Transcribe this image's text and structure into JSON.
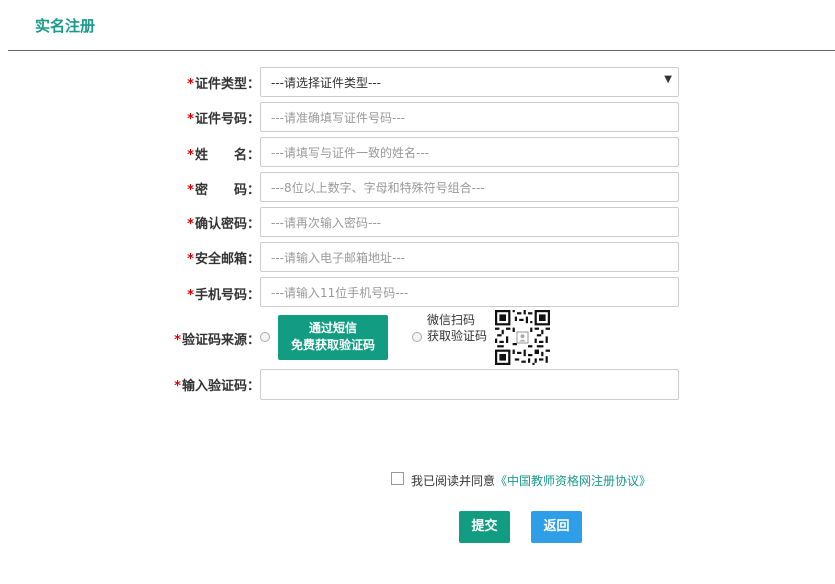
{
  "page": {
    "title": "实名注册"
  },
  "form": {
    "id_type": {
      "label": "证件类型：",
      "value": "---请选择证件类型---"
    },
    "id_number": {
      "label": "证件号码：",
      "placeholder": "---请准确填写证件号码---"
    },
    "name": {
      "label": "姓　　名：",
      "placeholder": "---请填写与证件一致的姓名---"
    },
    "password": {
      "label": "密　　码：",
      "placeholder": "---8位以上数字、字母和特殊符号组合---"
    },
    "confirm_password": {
      "label": "确认密码：",
      "placeholder": "---请再次输入密码---"
    },
    "email": {
      "label": "安全邮箱：",
      "placeholder": "---请输入电子邮箱地址---"
    },
    "phone": {
      "label": "手机号码：",
      "placeholder": "---请输入11位手机号码---"
    },
    "code_source": {
      "label": "验证码来源：",
      "sms_line1": "通过短信",
      "sms_line2": "免费获取验证码",
      "wechat_line1": "微信扫码",
      "wechat_line2": "获取验证码"
    },
    "code_input": {
      "label": "输入验证码：",
      "placeholder": ""
    },
    "required_mark": "*"
  },
  "agreement": {
    "text": "我已阅读并同意",
    "link": "《中国教师资格网注册协议》"
  },
  "buttons": {
    "submit": "提交",
    "back": "返回"
  },
  "icons": {
    "qr": "qr-code-icon",
    "dropdown": "chevron-down-icon"
  },
  "colors": {
    "accent": "#129c82",
    "blue": "#2f9ee9",
    "required": "#dd0000"
  }
}
